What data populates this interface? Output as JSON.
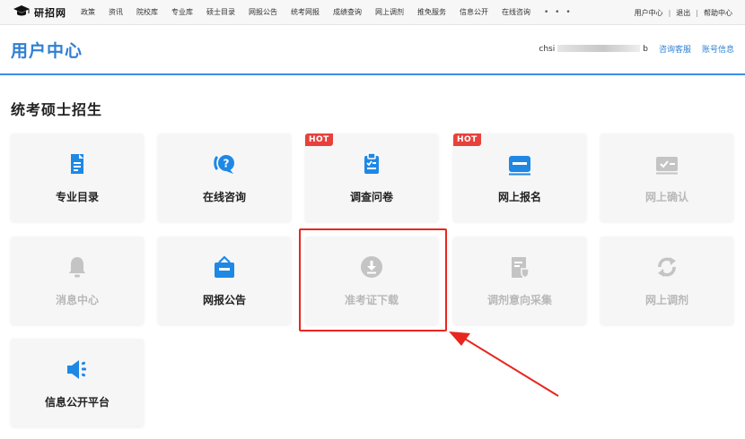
{
  "topbar": {
    "logo_text": "研招网",
    "nav_items": [
      "政策",
      "资讯",
      "院校库",
      "专业库",
      "硕士目录",
      "网报公告",
      "统考网报",
      "成绩查询",
      "网上调剂",
      "推免服务",
      "信息公开",
      "在线咨询"
    ],
    "more": "• • •",
    "right_links": [
      "用户中心",
      "退出",
      "帮助中心"
    ]
  },
  "header": {
    "title": "用户中心",
    "username_prefix": "chsi",
    "username_suffix": "b",
    "links": [
      "咨询客服",
      "账号信息"
    ]
  },
  "section": {
    "title": "统考硕士招生"
  },
  "cards": [
    {
      "label": "专业目录",
      "icon": "document-list-icon",
      "hot": "",
      "enabled": true
    },
    {
      "label": "在线咨询",
      "icon": "chat-question-icon",
      "hot": "",
      "enabled": true
    },
    {
      "label": "调查问卷",
      "icon": "clipboard-check-icon",
      "hot": "HOT",
      "enabled": true
    },
    {
      "label": "网上报名",
      "icon": "id-card-icon",
      "hot": "HOT",
      "enabled": true
    },
    {
      "label": "网上确认",
      "icon": "verify-card-icon",
      "hot": "",
      "enabled": false
    },
    {
      "label": "消息中心",
      "icon": "bell-icon",
      "hot": "",
      "enabled": false
    },
    {
      "label": "网报公告",
      "icon": "announcement-bag-icon",
      "hot": "",
      "enabled": true
    },
    {
      "label": "准考证下载",
      "icon": "download-circle-icon",
      "hot": "",
      "enabled": false
    },
    {
      "label": "调剂意向采集",
      "icon": "document-shield-icon",
      "hot": "",
      "enabled": false
    },
    {
      "label": "网上调剂",
      "icon": "refresh-icon",
      "hot": "",
      "enabled": false
    },
    {
      "label": "信息公开平台",
      "icon": "speaker-icon",
      "hot": "",
      "enabled": true
    }
  ],
  "colors": {
    "accent": "#2f7fd3",
    "icon_blue": "#1e88e5",
    "disabled": "#c4c4c4",
    "hot": "#e8413c",
    "highlight": "#e8261f"
  }
}
